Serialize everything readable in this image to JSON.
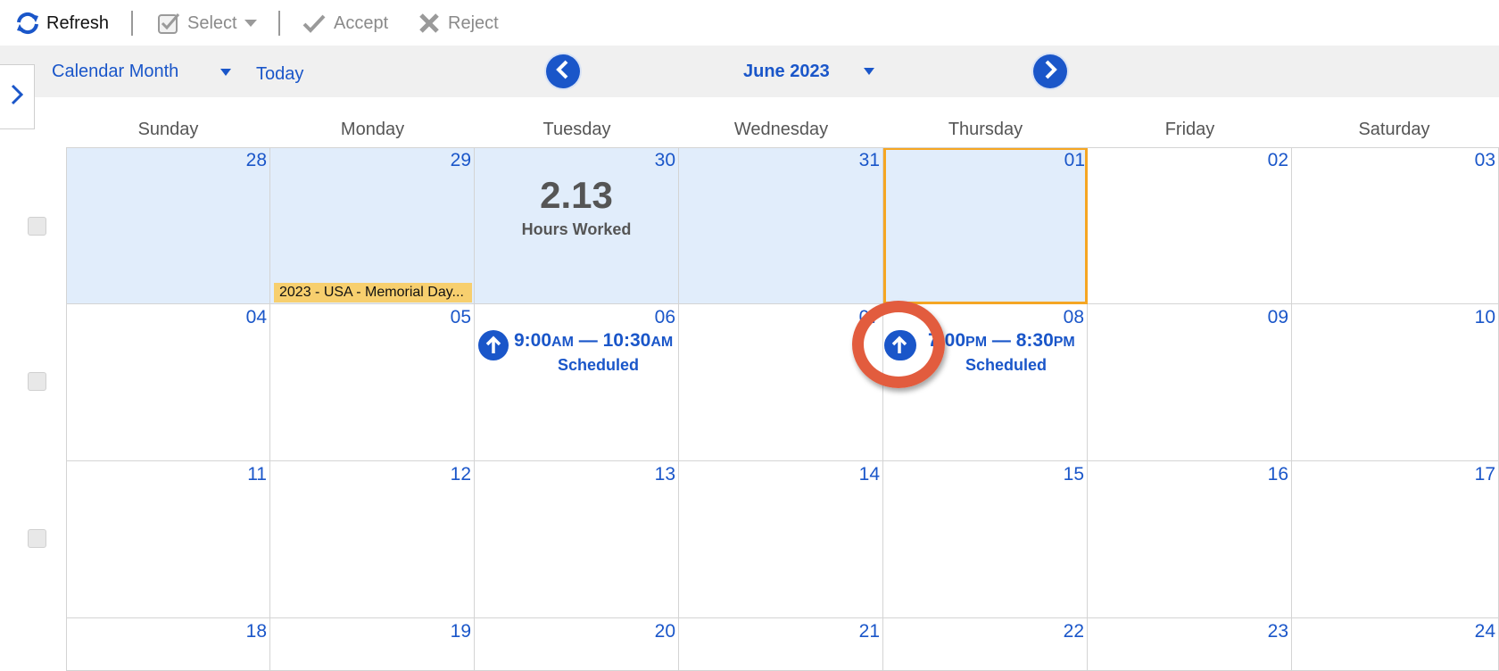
{
  "toolbar": {
    "refresh_label": "Refresh",
    "select_label": "Select",
    "accept_label": "Accept",
    "reject_label": "Reject"
  },
  "nav": {
    "view_label": "Calendar Month",
    "today_label": "Today",
    "month_label": "June 2023"
  },
  "weekdays": [
    "Sunday",
    "Monday",
    "Tuesday",
    "Wednesday",
    "Thursday",
    "Friday",
    "Saturday"
  ],
  "weeks": [
    [
      "28",
      "29",
      "30",
      "31",
      "01",
      "02",
      "03"
    ],
    [
      "04",
      "05",
      "06",
      "07",
      "08",
      "09",
      "10"
    ],
    [
      "11",
      "12",
      "13",
      "14",
      "15",
      "16",
      "17"
    ],
    [
      "18",
      "19",
      "20",
      "21",
      "22",
      "23",
      "24"
    ]
  ],
  "hours_worked": {
    "value": "2.13",
    "label": "Hours Worked"
  },
  "holiday": {
    "label": "2023 - USA - Memorial Day..."
  },
  "events": [
    {
      "start": "9:00",
      "start_ampm": "AM",
      "end": "10:30",
      "end_ampm": "AM",
      "separator": "—",
      "status": "Scheduled"
    },
    {
      "start": "7:00",
      "start_ampm": "PM",
      "end": "8:30",
      "end_ampm": "PM",
      "separator": "—",
      "status": "Scheduled"
    }
  ],
  "colors": {
    "accent": "#1a56c9",
    "shaded_day": "#e1edfb",
    "today_border": "#f5a623",
    "holiday_bg": "#f7cf6e",
    "highlight_ring": "#e25c3e"
  }
}
